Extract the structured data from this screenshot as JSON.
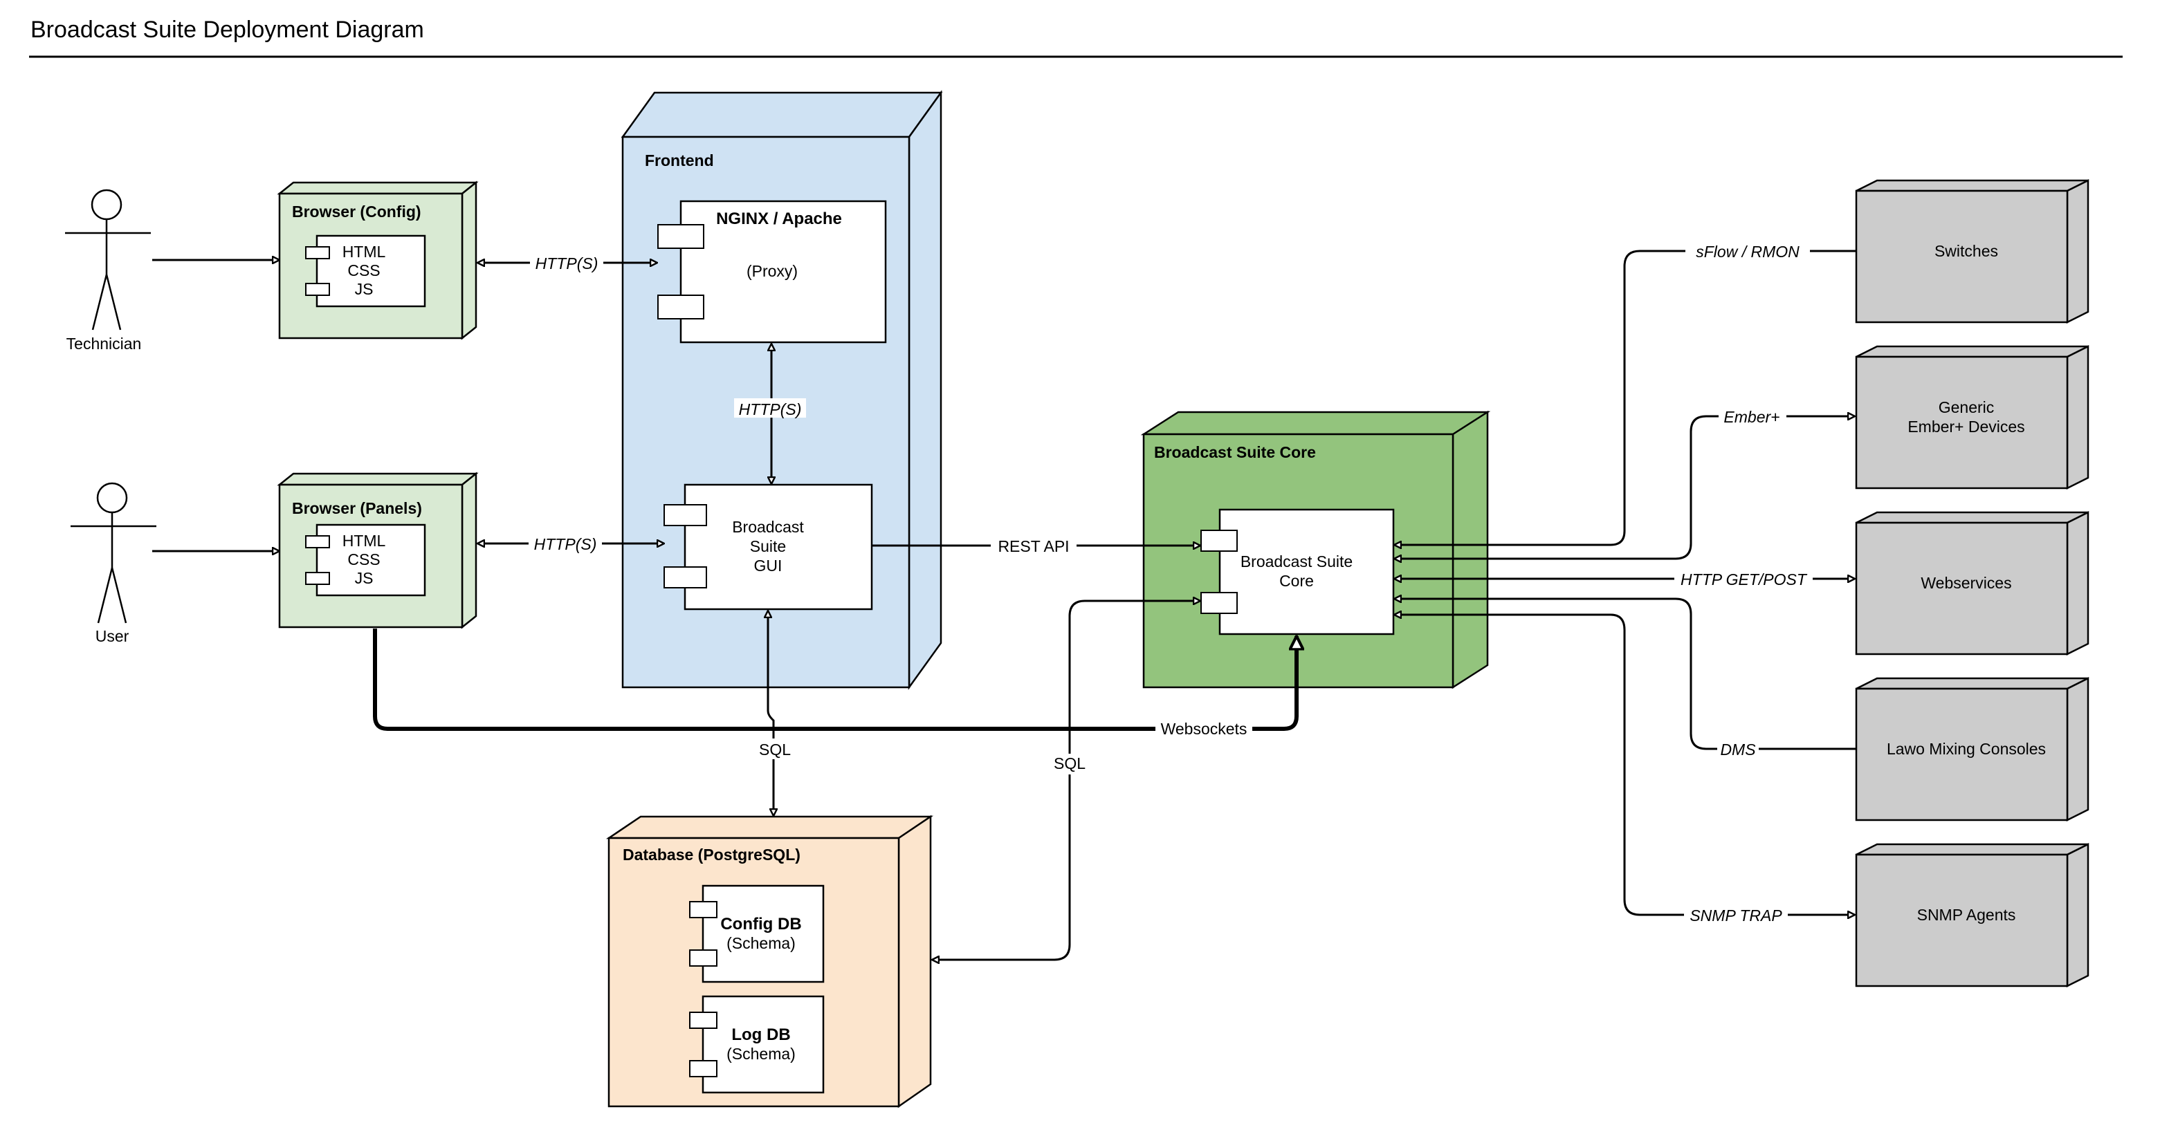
{
  "page": {
    "title": "Broadcast Suite Deployment Diagram"
  },
  "colors": {
    "browser_fill": "#d9ead3",
    "frontend_fill": "#cfe2f3",
    "core_fill": "#93c47d",
    "database_fill": "#fce5cd",
    "device_fill": "#cccccc",
    "component_fill": "#ffffff",
    "stroke": "#000000"
  },
  "actors": [
    {
      "id": "technician",
      "label": "Technician"
    },
    {
      "id": "user",
      "label": "User"
    }
  ],
  "nodes": {
    "browser_config": {
      "title": "Browser (Config)",
      "component_lines": [
        "HTML",
        "CSS",
        "JS"
      ]
    },
    "browser_panels": {
      "title": "Browser (Panels)",
      "component_lines": [
        "HTML",
        "CSS",
        "JS"
      ]
    },
    "frontend": {
      "title": "Frontend",
      "proxy": {
        "title": "NGINX / Apache",
        "subtitle": "(Proxy)"
      },
      "gui": {
        "lines": [
          "Broadcast",
          "Suite",
          "GUI"
        ]
      }
    },
    "core": {
      "title": "Broadcast Suite Core",
      "component_lines": [
        "Broadcast Suite",
        "Core"
      ]
    },
    "database": {
      "title": "Database (PostgreSQL)",
      "config_db": {
        "title": "Config DB",
        "subtitle": "(Schema)"
      },
      "log_db": {
        "title": "Log DB",
        "subtitle": "(Schema)"
      }
    }
  },
  "devices": [
    {
      "id": "switches",
      "lines": [
        "Switches"
      ]
    },
    {
      "id": "ember",
      "lines": [
        "Generic",
        "Ember+ Devices"
      ]
    },
    {
      "id": "webservices",
      "lines": [
        "Webservices"
      ]
    },
    {
      "id": "lawo",
      "lines": [
        "Lawo Mixing Consoles"
      ]
    },
    {
      "id": "snmp",
      "lines": [
        "SNMP Agents"
      ]
    }
  ],
  "edges": {
    "config_to_proxy": "HTTP(S)",
    "panels_to_gui": "HTTP(S)",
    "proxy_to_gui": "HTTP(S)",
    "gui_to_core": "REST API",
    "panels_to_core": "Websockets",
    "gui_to_db": "SQL",
    "core_to_db": "SQL",
    "switches": "sFlow / RMON",
    "ember": "Ember+",
    "webservices": "HTTP GET/POST",
    "lawo": "DMS",
    "snmp": "SNMP TRAP"
  }
}
